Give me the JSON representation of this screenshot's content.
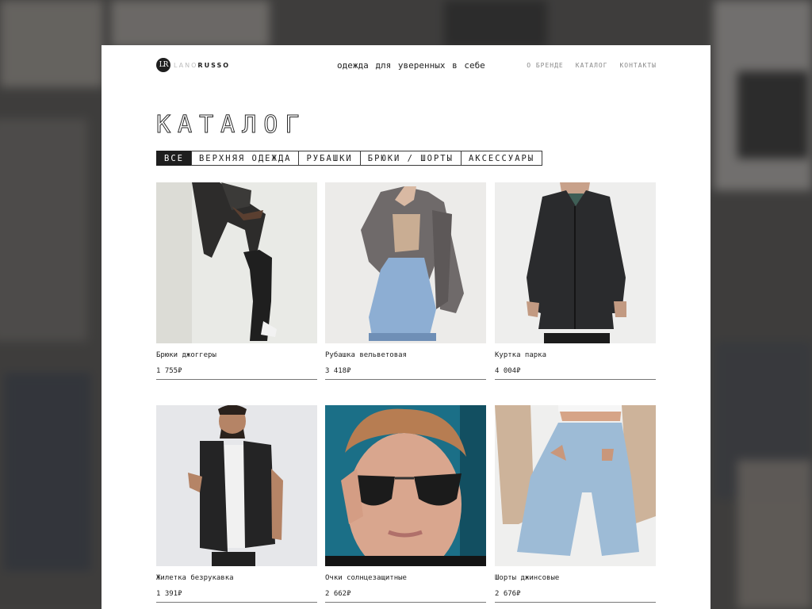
{
  "brand": {
    "logo_initials": "LR",
    "logo_light": "LANO",
    "logo_bold": "RUSSO"
  },
  "header": {
    "tagline": "одежда для уверенных в себе",
    "nav": [
      "О БРЕНДЕ",
      "КАТАЛОГ",
      "КОНТАКТЫ"
    ]
  },
  "catalog": {
    "title": "КАТАЛОГ",
    "filters": [
      "ВСЕ",
      "ВЕРХНЯЯ ОДЕЖДА",
      "РУБАШКИ",
      "БРЮКИ / ШОРТЫ",
      "АКСЕССУАРЫ"
    ],
    "active_filter": "ВСЕ"
  },
  "products": [
    {
      "name": "Брюки джоггеры",
      "price": "1 755₽"
    },
    {
      "name": "Рубашка вельветовая",
      "price": "3 418₽"
    },
    {
      "name": "Куртка парка",
      "price": "4 004₽"
    },
    {
      "name": "Жилетка безрукавка",
      "price": "1 391₽"
    },
    {
      "name": "Очки солнцезащитные",
      "price": "2 662₽"
    },
    {
      "name": "Шорты джинсовые",
      "price": "2 676₽"
    }
  ],
  "colors": {
    "accent": "#1e1e1e",
    "page_bg": "#ffffff",
    "backdrop": "#5a5856"
  }
}
